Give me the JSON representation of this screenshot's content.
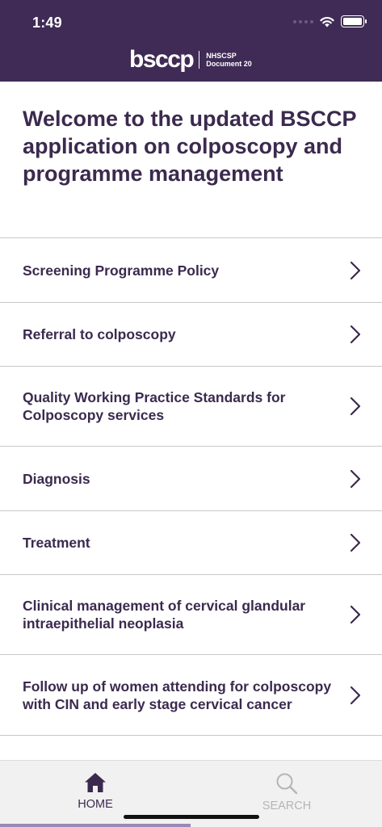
{
  "status_bar": {
    "time": "1:49"
  },
  "header": {
    "logo_text": "bsccp",
    "logo_sub_line1": "NHSCSP",
    "logo_sub_line2": "Document 20"
  },
  "welcome": "Welcome to the updated BSCCP application on colposcopy and programme management",
  "menu": [
    {
      "label": "Screening Programme Policy"
    },
    {
      "label": "Referral to colposcopy"
    },
    {
      "label": "Quality Working Practice Standards for Colposcopy services"
    },
    {
      "label": "Diagnosis"
    },
    {
      "label": "Treatment"
    },
    {
      "label": "Clinical management of cervical glandular intraepithelial neoplasia"
    },
    {
      "label": "Follow up of women attending for colposcopy with CIN and early stage cervical cancer"
    }
  ],
  "tabs": {
    "home": {
      "label": "HOME",
      "icon": "home-icon",
      "active": true
    },
    "search": {
      "label": "SEARCH",
      "icon": "search-icon",
      "active": false
    }
  },
  "colors": {
    "brand": "#3f2b55",
    "text": "#3b2a4e",
    "accent": "#9b87b8"
  }
}
